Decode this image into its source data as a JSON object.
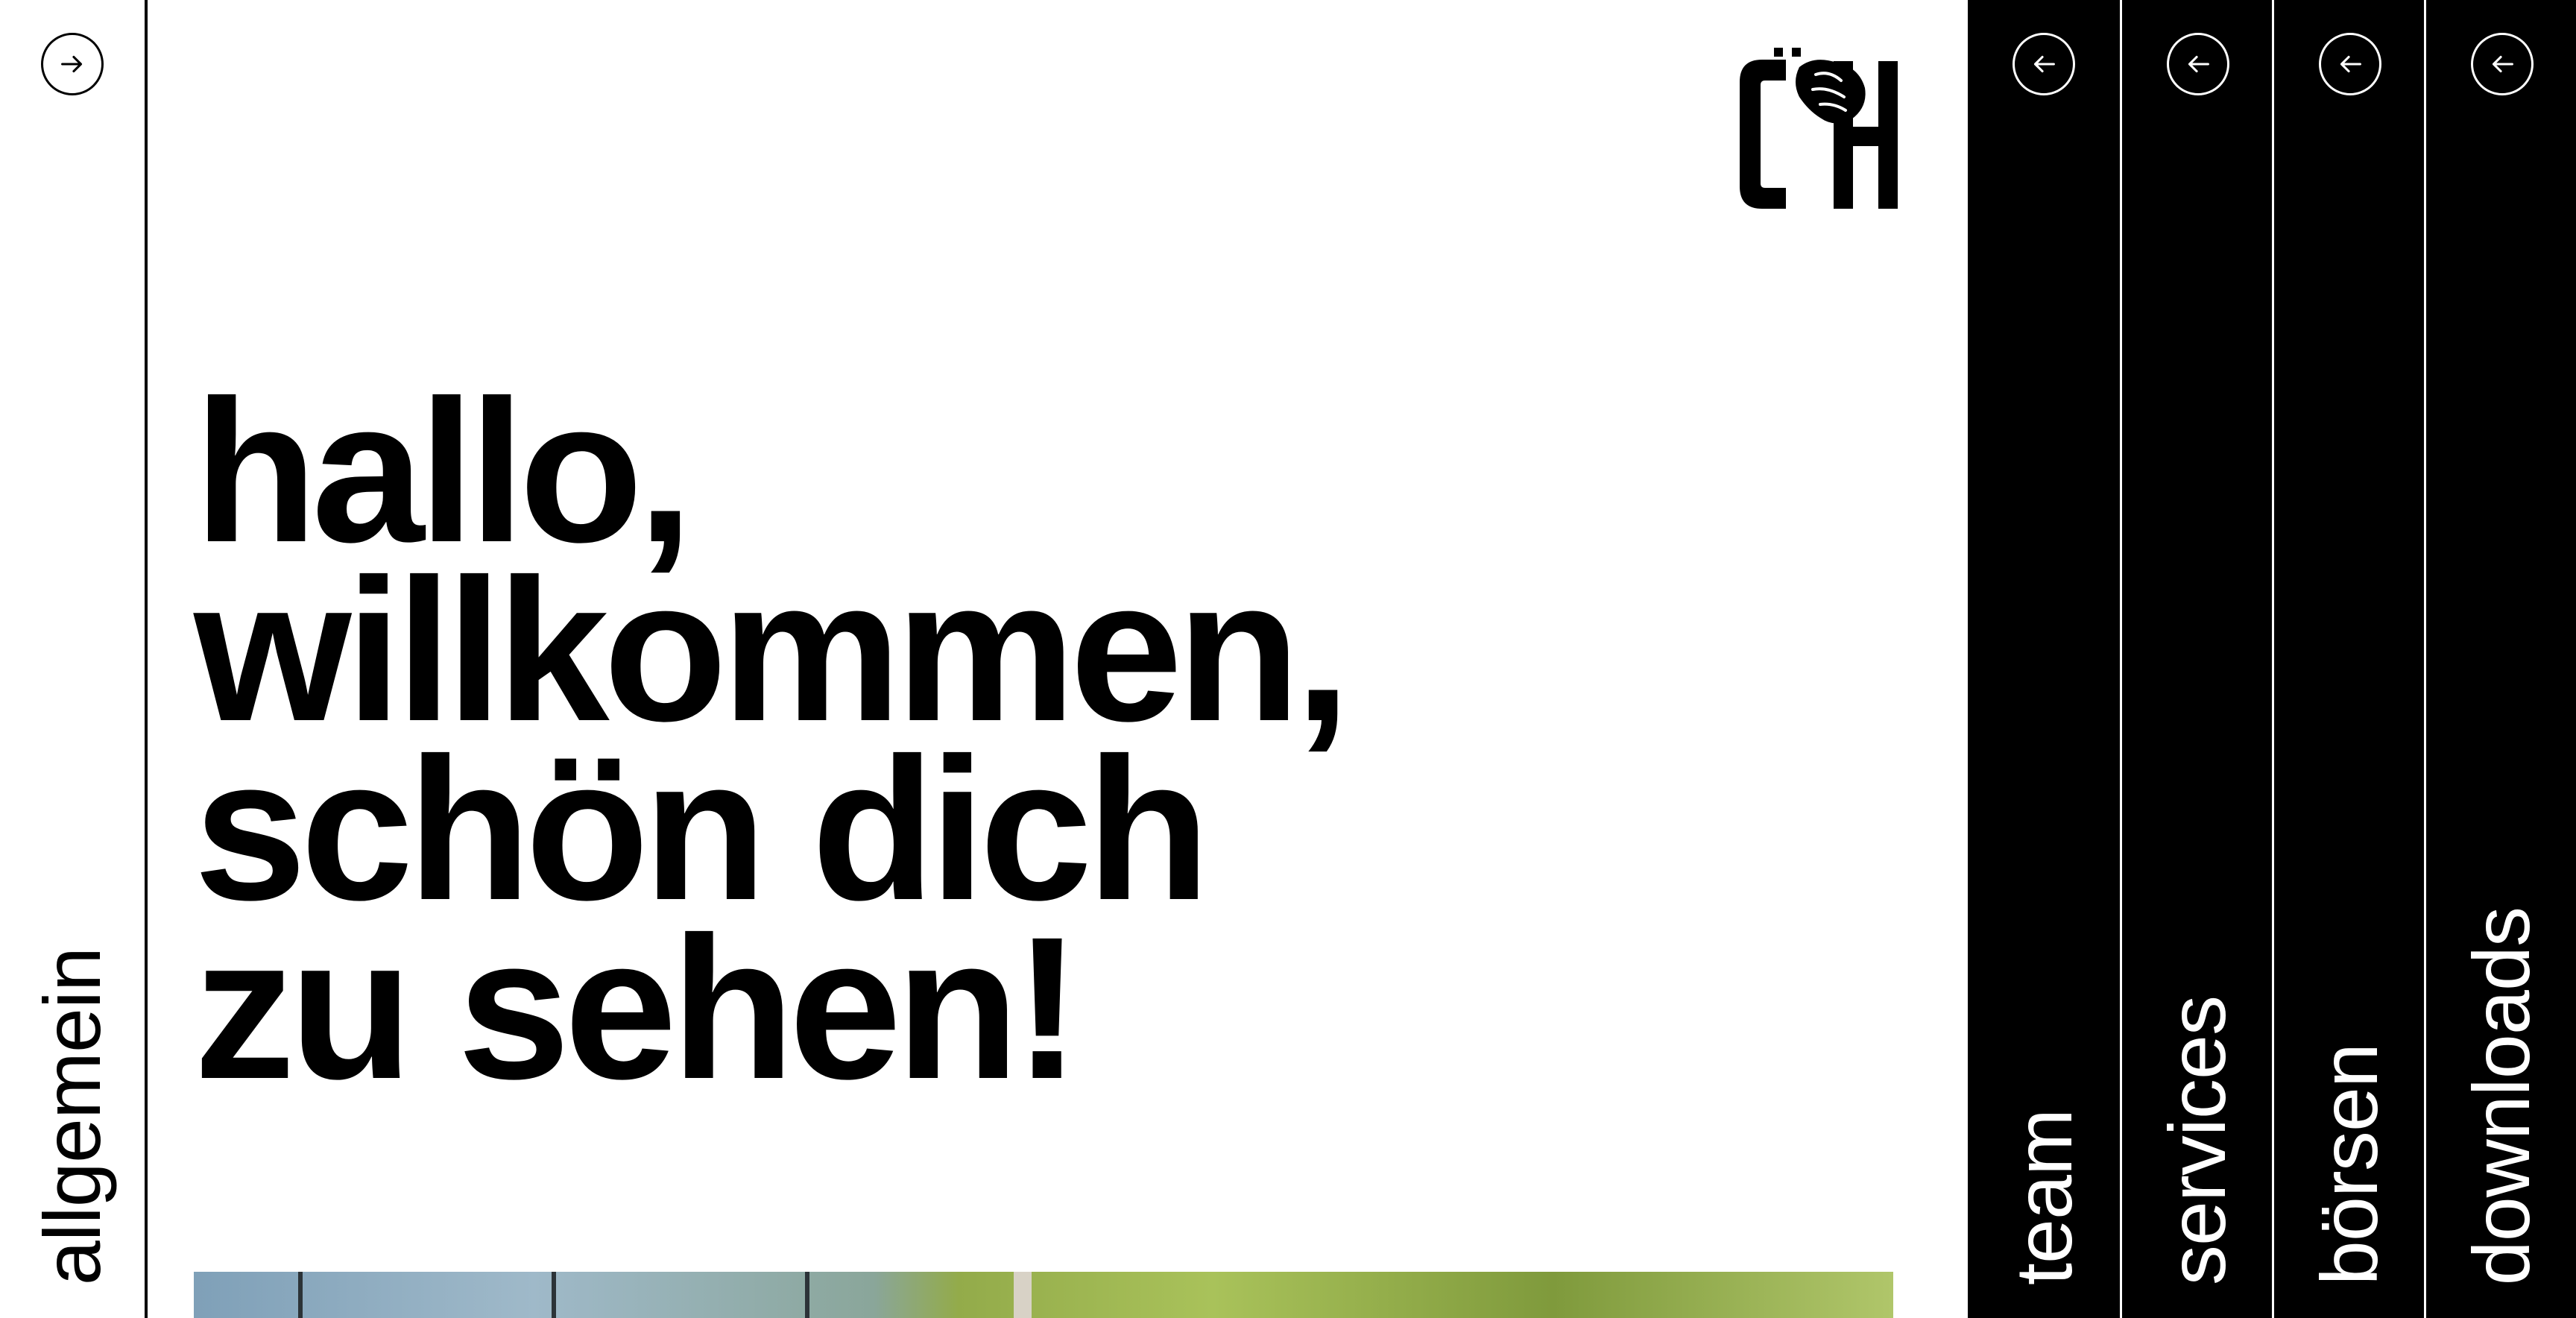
{
  "sidebar_left": {
    "label": "allgemein",
    "toggle_icon": "arrow-right-circle-icon"
  },
  "logo": {
    "mark": "CH",
    "icon": "handshake-icon"
  },
  "headline": {
    "lines": [
      "hallo,",
      "willkommen,",
      "schön dich",
      "zu sehen!"
    ]
  },
  "hero_image": {
    "description": ""
  },
  "nav": {
    "items": [
      {
        "label": "team",
        "icon": "arrow-left-circle-icon"
      },
      {
        "label": "services",
        "icon": "arrow-left-circle-icon"
      },
      {
        "label": "börsen",
        "icon": "arrow-left-circle-icon"
      },
      {
        "label": "downloads",
        "icon": "arrow-left-circle-icon"
      }
    ]
  },
  "colors": {
    "background": "#ffffff",
    "text": "#000000",
    "nav_background": "#000000",
    "nav_text": "#ffffff"
  }
}
